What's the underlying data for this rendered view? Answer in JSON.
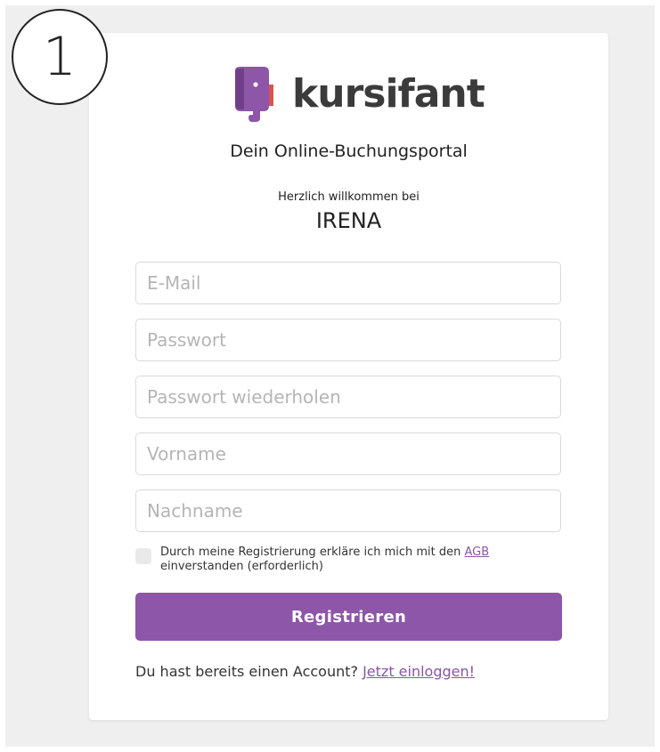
{
  "step": {
    "number": "1"
  },
  "brand": {
    "name": "kursifant",
    "tagline": "Dein Online-Buchungsportal",
    "icon": "kursifant-elephant-logo-icon",
    "colors": {
      "primary": "#8d56a9",
      "accent_orange": "#f08a24",
      "accent_red": "#d9534f"
    }
  },
  "welcome": {
    "text": "Herzlich willkommen bei",
    "organization": "IRENA"
  },
  "form": {
    "email_placeholder": "E-Mail",
    "email_value": "",
    "password_placeholder": "Passwort",
    "password_value": "",
    "password_repeat_placeholder": "Passwort wiederholen",
    "password_repeat_value": "",
    "firstname_placeholder": "Vorname",
    "firstname_value": "",
    "lastname_placeholder": "Nachname",
    "lastname_value": "",
    "agb": {
      "checked": false,
      "text_before": "Durch meine Registrierung erkläre ich mich mit den ",
      "link_label": "AGB",
      "text_after": " einverstanden (erforderlich)"
    },
    "submit_label": "Registrieren"
  },
  "login": {
    "prompt": "Du hast bereits einen Account? ",
    "link_label": "Jetzt einloggen!"
  }
}
